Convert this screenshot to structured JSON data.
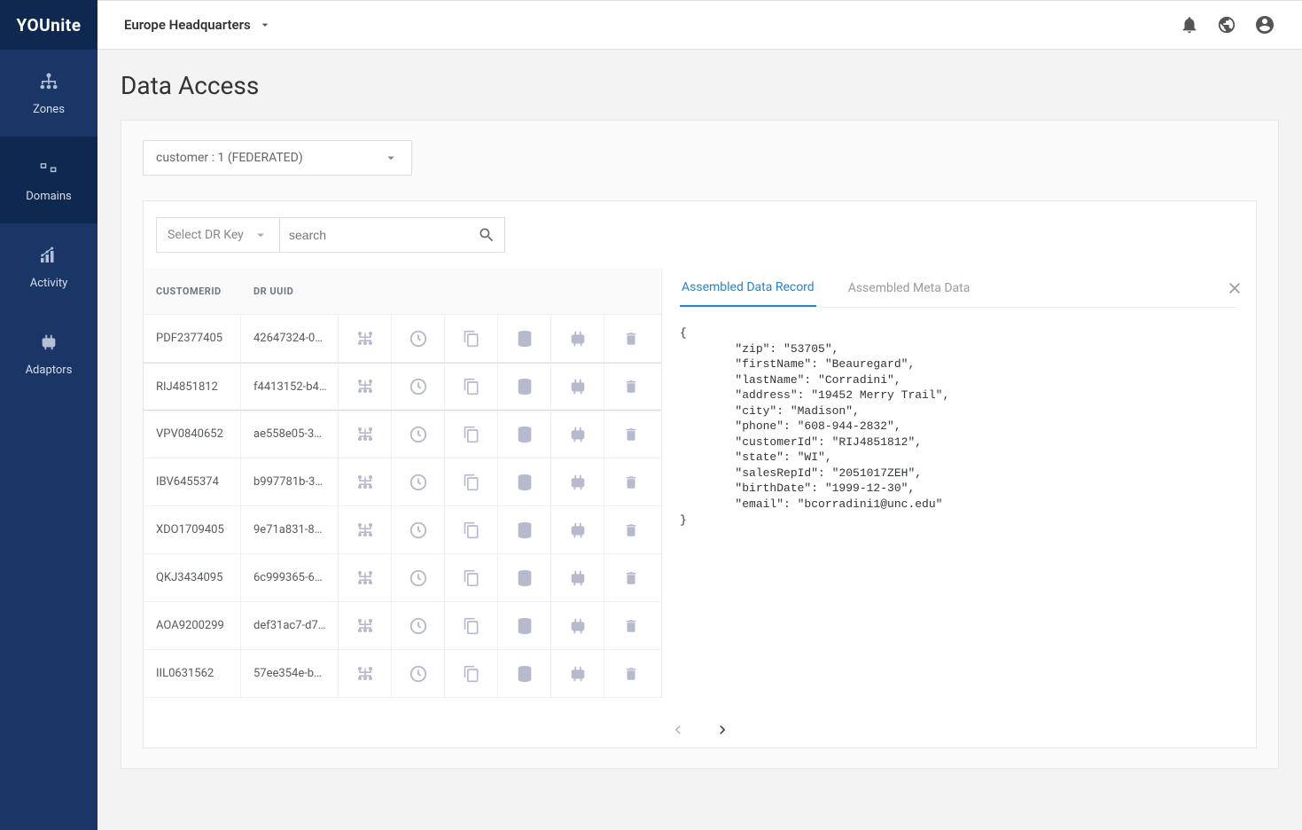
{
  "app": {
    "logo": "YOUnite",
    "zone": "Europe Headquarters"
  },
  "sidebar": {
    "items": [
      {
        "label": "Zones"
      },
      {
        "label": "Domains"
      },
      {
        "label": "Activity"
      },
      {
        "label": "Adaptors"
      }
    ],
    "activeIndex": 1
  },
  "page": {
    "title": "Data Access"
  },
  "domainSelect": {
    "value": "customer : 1 (FEDERATED)"
  },
  "drKey": {
    "label": "Select DR Key"
  },
  "search": {
    "placeholder": "search"
  },
  "table": {
    "headers": {
      "customerId": "CUSTOMERID",
      "drUuid": "DR UUID"
    },
    "rows": [
      {
        "cid": "PDF2377405",
        "uuid": "42647324-0…"
      },
      {
        "cid": "RIJ4851812",
        "uuid": "f4413152-b4…"
      },
      {
        "cid": "VPV0840652",
        "uuid": "ae558e05-3…"
      },
      {
        "cid": "IBV6455374",
        "uuid": "b997781b-3…"
      },
      {
        "cid": "XDO1709405",
        "uuid": "9e71a831-8…"
      },
      {
        "cid": "QKJ3434095",
        "uuid": "6c999365-6…"
      },
      {
        "cid": "AOA9200299",
        "uuid": "def31ac7-d7…"
      },
      {
        "cid": "IIL0631562",
        "uuid": "57ee354e-b…"
      }
    ],
    "selectedIndex": 1
  },
  "detail": {
    "tabs": {
      "assembled": "Assembled Data Record",
      "meta": "Assembled Meta Data"
    },
    "record": {
      "zip": "53705",
      "firstName": "Beauregard",
      "lastName": "Corradini",
      "address": "19452 Merry Trail",
      "city": "Madison",
      "phone": "608-944-2832",
      "customerId": "RIJ4851812",
      "state": "WI",
      "salesRepId": "2051017ZEH",
      "birthDate": "1999-12-30",
      "email": "bcorradini1@unc.edu"
    }
  }
}
